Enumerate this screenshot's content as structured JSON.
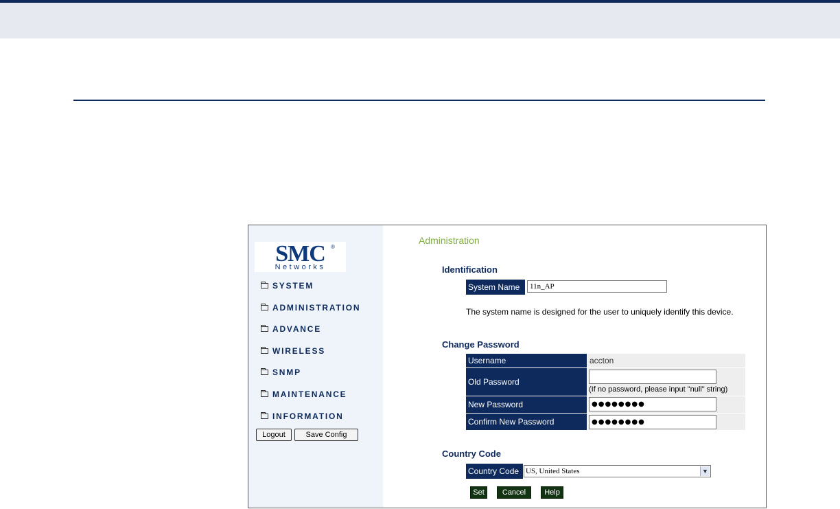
{
  "logo": {
    "brand": "SMC",
    "reg": "®",
    "sub": "Networks"
  },
  "nav": {
    "system": "SYSTEM",
    "administration": "ADMINISTRATION",
    "advance": "ADVANCE",
    "wireless": "WIRELESS",
    "snmp": "SNMP",
    "maintenance": "MAINTENANCE",
    "information": "INFORMATION"
  },
  "sidebar_buttons": {
    "logout": "Logout",
    "save_config": "Save Config"
  },
  "page_title": "Administration",
  "identification": {
    "heading": "Identification",
    "system_name_label": "System Name",
    "system_name_value": "11n_AP",
    "description": "The system name is designed for the user to uniquely identify this device."
  },
  "change_password": {
    "heading": "Change Password",
    "username_label": "Username",
    "username_value": "accton",
    "old_password_label": "Old Password",
    "old_password_value": "",
    "old_password_note": "(If no password, please input \"null\" string)",
    "new_password_label": "New Password",
    "new_password_value": "●●●●●●●●",
    "confirm_password_label": "Confirm New Password",
    "confirm_password_value": "●●●●●●●●"
  },
  "country": {
    "heading": "Country Code",
    "label": "Country Code",
    "selected": "US, United States"
  },
  "actions": {
    "set": "Set",
    "cancel": "Cancel",
    "help": "Help"
  },
  "colors": {
    "navy": "#0e2a5c",
    "title_green": "#7fb03a",
    "button_green": "#113311",
    "sidebar_bg": "#eef4fa"
  }
}
